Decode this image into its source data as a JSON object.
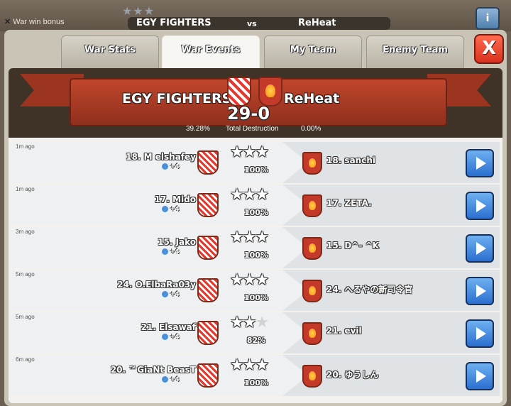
{
  "topbar": {
    "war_win_bonus": "War win bonus",
    "clan_left": "EGY FIGHTERS",
    "vs": "vs",
    "clan_right": "ReHeat",
    "info": "i"
  },
  "tabs": [
    {
      "label": "War Stats",
      "active": false
    },
    {
      "label": "War Events",
      "active": true
    },
    {
      "label": "My Team",
      "active": false
    },
    {
      "label": "Enemy Team",
      "active": false
    }
  ],
  "close_label": "X",
  "header": {
    "clan_left": "EGY FIGHTERS",
    "clan_right": "ReHeat",
    "score": "29-0",
    "left_destruction": "39.28%",
    "destruction_label": "Total Destruction",
    "right_destruction": "0.00%"
  },
  "events": [
    {
      "ago": "1m ago",
      "attacker": "18. M elshafey",
      "gain": "+4",
      "stars": 3,
      "percent": "100%",
      "defender": "18. sanchi"
    },
    {
      "ago": "1m ago",
      "attacker": "17. Mido",
      "gain": "+4",
      "stars": 3,
      "percent": "100%",
      "defender": "17. ZETA."
    },
    {
      "ago": "3m ago",
      "attacker": "15. Jako",
      "gain": "+4",
      "stars": 3,
      "percent": "100%",
      "defender": "15. D^- ^K"
    },
    {
      "ago": "5m ago",
      "attacker": "24. O.ElbaRa03y",
      "gain": "+4",
      "stars": 3,
      "percent": "100%",
      "defender": "24. へるやの新司令官"
    },
    {
      "ago": "5m ago",
      "attacker": "21. Elsawaf",
      "gain": "+4",
      "stars": 2,
      "percent": "82%",
      "defender": "21. evil"
    },
    {
      "ago": "6m ago",
      "attacker": "20. ™GiaNt BeasT",
      "gain": "+4",
      "stars": 3,
      "percent": "100%",
      "defender": "20. ゆうしん"
    }
  ],
  "colors": {
    "accent_red": "#c0472c",
    "play_blue": "#2a6fd0",
    "close_red": "#d8321e"
  }
}
